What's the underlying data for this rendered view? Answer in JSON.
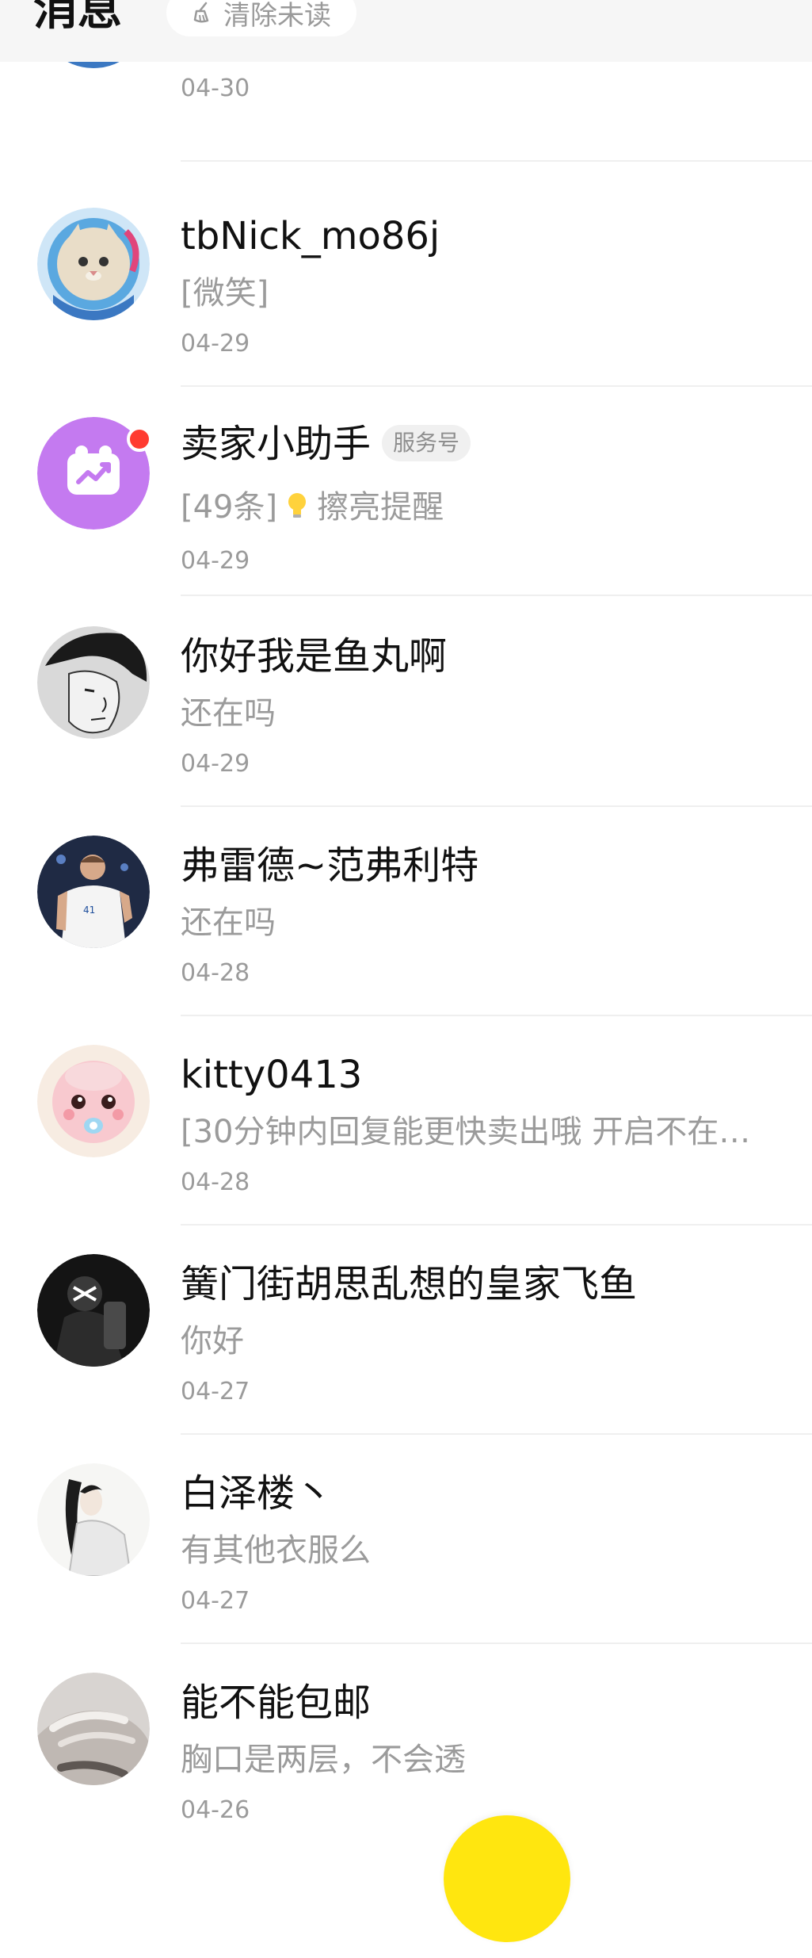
{
  "header": {
    "title": "消息",
    "clear_unread_label": "清除未读"
  },
  "conversations": [
    {
      "name": "",
      "preview": "",
      "date": "04-30",
      "avatar": "cat-astronaut-avatar"
    },
    {
      "name": "tbNick_mo86j",
      "preview": "[微笑]",
      "date": "04-29",
      "avatar": "cat-astronaut-avatar"
    },
    {
      "name": "卖家小助手",
      "tag": "服务号",
      "preview_prefix": "[49条]",
      "preview": "擦亮提醒",
      "date": "04-29",
      "avatar": "seller-assistant-avatar",
      "unread": true
    },
    {
      "name": "你好我是鱼丸啊",
      "preview": "还在吗",
      "date": "04-29",
      "avatar": "manga-portrait-avatar"
    },
    {
      "name": "弗雷德~范弗利特",
      "preview": "还在吗",
      "date": "04-28",
      "avatar": "basketball-player-avatar"
    },
    {
      "name": "kitty0413",
      "preview": "[30分钟内回复能更快卖出哦 开启不在…",
      "date": "04-28",
      "avatar": "pink-cartoon-avatar"
    },
    {
      "name": "簧门街胡思乱想的皇家飞鱼",
      "preview": "你好",
      "date": "04-27",
      "avatar": "dark-figure-avatar"
    },
    {
      "name": "白泽楼丶",
      "preview": "有其他衣服么",
      "date": "04-27",
      "avatar": "ink-portrait-avatar"
    },
    {
      "name": "能不能包邮",
      "preview": "胸口是两层，不会透",
      "date": "04-26",
      "avatar": "hand-photo-avatar"
    }
  ],
  "colors": {
    "accent": "#ffe60f",
    "unread_dot": "#ff3b30",
    "assistant_purple": "#c47af0"
  }
}
